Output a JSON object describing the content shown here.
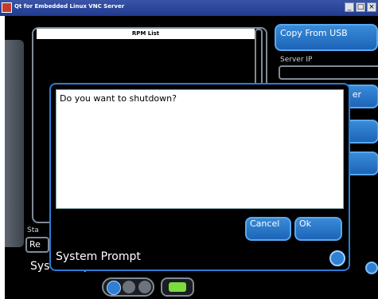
{
  "window": {
    "title": "Qt for Embedded Linux VNC Server",
    "controls": [
      "_",
      "□",
      "×"
    ]
  },
  "rpm_list": {
    "header": "RPM List"
  },
  "right_panel": {
    "copy_usb_label": "Copy From USB",
    "server_ip_label": "Server IP",
    "server_ip_value": "",
    "peek_button_1": "er",
    "peek_button_2": "",
    "peek_button_3": ""
  },
  "status": {
    "label": "Sta",
    "field_text": "Re"
  },
  "main": {
    "system_update_label": "System Update"
  },
  "dialog": {
    "message": "Do you want to shutdown?",
    "cancel_label": "Cancel",
    "ok_label": "Ok",
    "title": "System Prompt"
  },
  "icons": {
    "app_icon": "app-icon",
    "power_icon": "power-icon",
    "close_icon": "close-icon"
  },
  "colors": {
    "accent_blue": "#2c7cd4",
    "indicator_green": "#7bdc3d",
    "background": "#000000"
  }
}
